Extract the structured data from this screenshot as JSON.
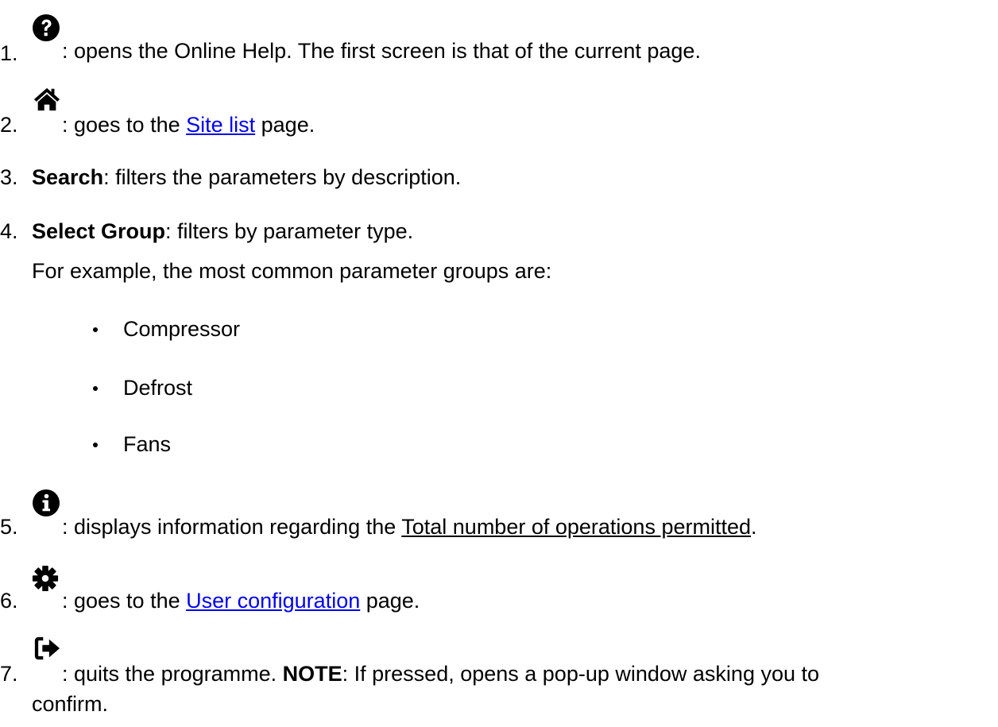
{
  "items": [
    {
      "number": "1.",
      "icon": "question-circle-icon",
      "text": ": opens the Online Help. The first screen is that of the current page."
    },
    {
      "number": "2.",
      "icon": "home-icon",
      "before": ": goes to the ",
      "link": "Site list",
      "after": " page."
    },
    {
      "number": "3.",
      "bold": "Search",
      "text": ": filters the parameters by description."
    },
    {
      "number": "4.",
      "bold": "Select Group",
      "text": ": filters by parameter type.",
      "subtext": "For example, the most common parameter groups are:",
      "bullets": [
        "Compressor",
        "Defrost",
        "Fans"
      ]
    },
    {
      "number": "5.",
      "icon": "info-circle-icon",
      "before": ": displays information regarding the ",
      "underlined": "Total number of operations permitted",
      "after": "."
    },
    {
      "number": "6.",
      "icon": "gear-icon",
      "before": ": goes to the ",
      "link": "User configuration",
      "after": " page."
    },
    {
      "number": "7.",
      "icon": "sign-out-icon",
      "text": ": quits the programme. ",
      "bold": "NOTE",
      "after": ": If pressed, opens a pop-up window asking you to",
      "continuation": "confirm."
    }
  ]
}
